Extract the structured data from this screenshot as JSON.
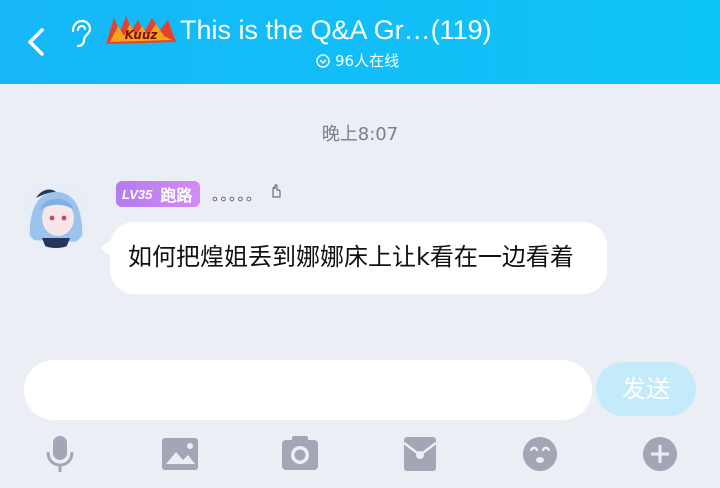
{
  "header": {
    "title": "This is the Q&A Gr…(119)",
    "online": "96人在线",
    "logo_text": "Kuuz"
  },
  "chat": {
    "time": "晚上8:07",
    "message": {
      "level": "LV35",
      "sender": "跑路",
      "status": "。。。。。",
      "text": "如何把煌姐丢到娜娜床上让k看在一边看着"
    }
  },
  "composer": {
    "input_value": "",
    "send_label": "发送"
  },
  "toolbar": {
    "icons": [
      "microphone-icon",
      "image-icon",
      "camera-icon",
      "red-packet-icon",
      "emoji-icon",
      "plus-icon"
    ]
  },
  "colors": {
    "header": "#14b8f7",
    "background": "#eceef6",
    "badge": "#c384f3",
    "send": "#c4ebf9",
    "toolbar_icon": "#a3a6b5"
  }
}
